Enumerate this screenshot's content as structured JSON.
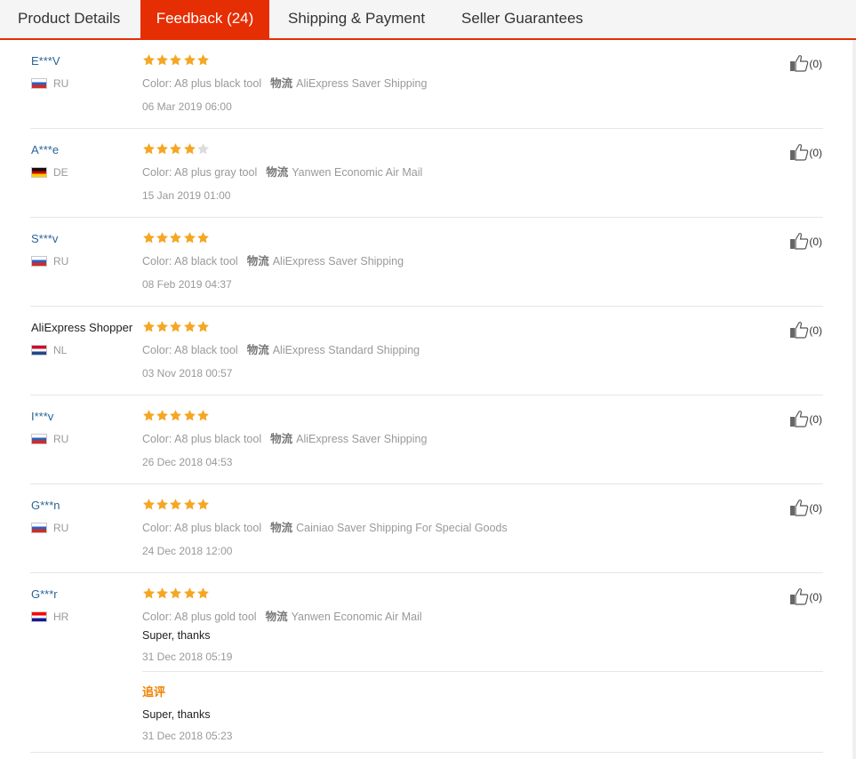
{
  "tabs": [
    {
      "label": "Product Details",
      "active": false
    },
    {
      "label": "Feedback (24)",
      "active": true
    },
    {
      "label": "Shipping & Payment",
      "active": false
    },
    {
      "label": "Seller Guarantees",
      "active": false
    }
  ],
  "colors": {
    "accent": "#e62e04",
    "star_filled": "#f5a623",
    "star_empty": "#dcdcdc",
    "username_link": "#2a6496",
    "followup_label": "#f08200"
  },
  "shipping_label": "物流",
  "reviews": [
    {
      "user": "E***V",
      "country": "RU",
      "flag": "ru",
      "rating": 5,
      "color": "Color: A8 plus black tool",
      "shipping": "AliExpress Saver Shipping",
      "date": "06 Mar 2019 06:00",
      "helpful": "(0)"
    },
    {
      "user": "A***e",
      "country": "DE",
      "flag": "de",
      "rating": 4,
      "color": "Color: A8 plus gray tool",
      "shipping": "Yanwen Economic Air Mail",
      "date": "15 Jan 2019 01:00",
      "helpful": "(0)"
    },
    {
      "user": "S***v",
      "country": "RU",
      "flag": "ru",
      "rating": 5,
      "color": "Color: A8 black tool",
      "shipping": "AliExpress Saver Shipping",
      "date": "08 Feb 2019 04:37",
      "helpful": "(0)"
    },
    {
      "user": "AliExpress Shopper",
      "country": "NL",
      "flag": "nl",
      "rating": 5,
      "color": "Color: A8 black tool",
      "shipping": "AliExpress Standard Shipping",
      "date": "03 Nov 2018 00:57",
      "helpful": "(0)"
    },
    {
      "user": "I***v",
      "country": "RU",
      "flag": "ru",
      "rating": 5,
      "color": "Color: A8 plus black tool",
      "shipping": "AliExpress Saver Shipping",
      "date": "26 Dec 2018 04:53",
      "helpful": "(0)"
    },
    {
      "user": "G***n",
      "country": "RU",
      "flag": "ru",
      "rating": 5,
      "color": "Color: A8 plus black tool",
      "shipping": "Cainiao Saver Shipping For Special Goods",
      "date": "24 Dec 2018 12:00",
      "helpful": "(0)"
    },
    {
      "user": "G***r",
      "country": "HR",
      "flag": "hr",
      "rating": 5,
      "color": "Color: A8 plus gold tool",
      "shipping": "Yanwen Economic Air Mail",
      "text": "Super, thanks",
      "date": "31 Dec 2018 05:19",
      "helpful": "(0)",
      "followup": {
        "label": "追评",
        "text": "Super, thanks",
        "date": "31 Dec 2018 05:23"
      }
    }
  ]
}
